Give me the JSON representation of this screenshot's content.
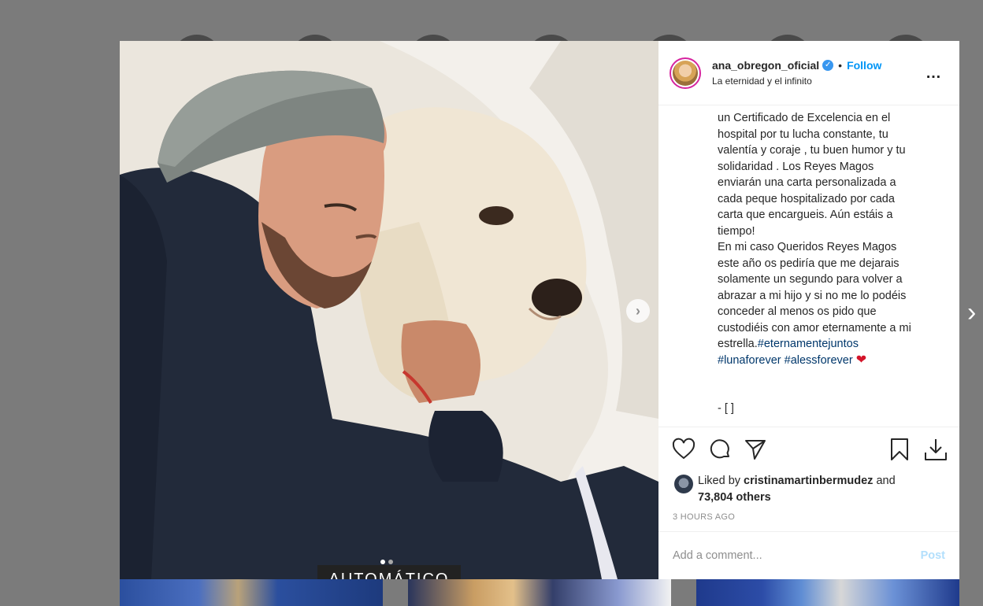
{
  "post": {
    "username": "ana_obregon_oficial",
    "verified_mark": "✓",
    "separator": "•",
    "follow_label": "Follow",
    "location": "La eternidad y el infinito",
    "more_label": "…",
    "photo_overlay_text": "AUTOMÁTICO",
    "carousel": {
      "count": 2,
      "active_index": 0
    },
    "caption_lines": [
      "un Certificado de Excelencia en el",
      "hospital por tu lucha constante, tu",
      "valentía y coraje , tu buen humor y tu",
      "solidaridad . Los Reyes Magos",
      "enviarán una carta personalizada a",
      "cada peque hospitalizado por cada",
      "carta que encargueis. Aún estáis a",
      "tiempo!",
      "En mi caso Queridos Reyes Magos",
      "este año os pediría que me dejarais",
      "solamente un segundo para volver a",
      "abrazar a mi hijo y si no me lo podéis",
      "conceder al menos os pido que",
      "custodiéis con amor eternamente a mi"
    ],
    "caption_tail": {
      "text": "estrella.",
      "hashtag1": "#eternamentejuntos",
      "hashtag2": "#lunaforever",
      "hashtag3": "#alessforever",
      "emoji": "❤"
    },
    "caption_end": "- [ ]",
    "likes": {
      "prefix": "Liked by",
      "user": "cristinamartinbermudez",
      "and": "and",
      "others": "73,804 others"
    },
    "timestamp": "3 HOURS AGO",
    "comment_placeholder": "Add a comment...",
    "post_label": "Post"
  },
  "icons": [
    "heart-icon",
    "comment-icon",
    "share-icon",
    "bookmark-icon",
    "download-icon",
    "chevron-right-icon",
    "more-options-icon",
    "verified-badge-icon"
  ],
  "colors": {
    "accent": "#0095f6",
    "post_disabled": "#b2dffc",
    "hashtag": "#00376b",
    "backdrop": "#7b7b7b"
  }
}
